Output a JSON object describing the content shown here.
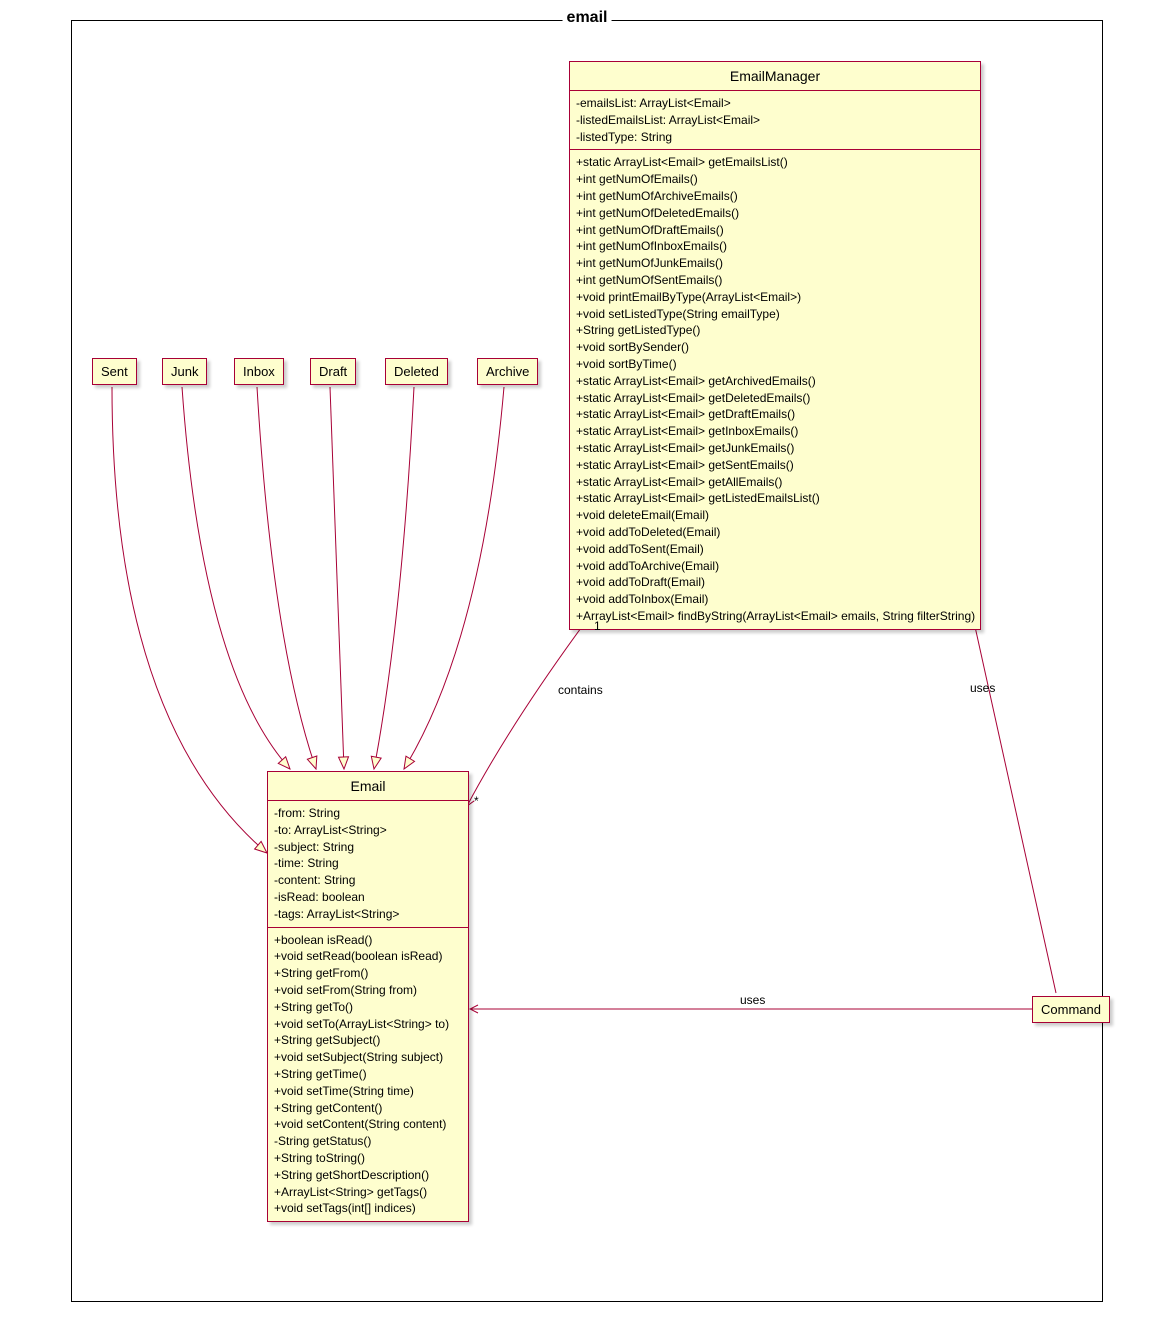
{
  "package": {
    "name": "email"
  },
  "classes": {
    "emailManager": {
      "name": "EmailManager",
      "attributes": [
        "-emailsList: ArrayList<Email>",
        "-listedEmailsList: ArrayList<Email>",
        "-listedType: String"
      ],
      "methods": [
        "+static ArrayList<Email> getEmailsList()",
        "+int getNumOfEmails()",
        "+int getNumOfArchiveEmails()",
        "+int getNumOfDeletedEmails()",
        "+int getNumOfDraftEmails()",
        "+int getNumOfInboxEmails()",
        "+int getNumOfJunkEmails()",
        "+int getNumOfSentEmails()",
        "+void printEmailByType(ArrayList<Email>)",
        "+void setListedType(String emailType)",
        "+String getListedType()",
        "+void sortBySender()",
        "+void sortByTime()",
        "+static ArrayList<Email> getArchivedEmails()",
        "+static ArrayList<Email> getDeletedEmails()",
        "+static ArrayList<Email> getDraftEmails()",
        "+static ArrayList<Email> getInboxEmails()",
        "+static ArrayList<Email> getJunkEmails()",
        "+static ArrayList<Email> getSentEmails()",
        "+static ArrayList<Email> getAllEmails()",
        "+static ArrayList<Email> getListedEmailsList()",
        "+void deleteEmail(Email)",
        "+void addToDeleted(Email)",
        "+void addToSent(Email)",
        "+void addToArchive(Email)",
        "+void addToDraft(Email)",
        "+void addToInbox(Email)",
        "+ArrayList<Email> findByString(ArrayList<Email> emails, String filterString)"
      ]
    },
    "email": {
      "name": "Email",
      "attributes": [
        "-from: String",
        "-to: ArrayList<String>",
        "-subject: String",
        "-time: String",
        "-content: String",
        "-isRead: boolean",
        "-tags: ArrayList<String>"
      ],
      "methods": [
        "+boolean isRead()",
        "+void setRead(boolean isRead)",
        "+String getFrom()",
        "+void setFrom(String from)",
        "+String getTo()",
        "+void setTo(ArrayList<String> to)",
        "+String getSubject()",
        "+void setSubject(String subject)",
        "+String getTime()",
        "+void setTime(String time)",
        "+String getContent()",
        "+void setContent(String content)",
        "-String getStatus()",
        "+String toString()",
        "+String getShortDescription()",
        "+ArrayList<String> getTags()",
        "+void setTags(int[] indices)"
      ]
    }
  },
  "smallClasses": {
    "sent": "Sent",
    "junk": "Junk",
    "inbox": "Inbox",
    "draft": "Draft",
    "deleted": "Deleted",
    "archive": "Archive",
    "command": "Command"
  },
  "relationships": {
    "contains": "contains",
    "uses1": "uses",
    "uses2": "uses",
    "mult_one": "1",
    "mult_many": "*"
  }
}
